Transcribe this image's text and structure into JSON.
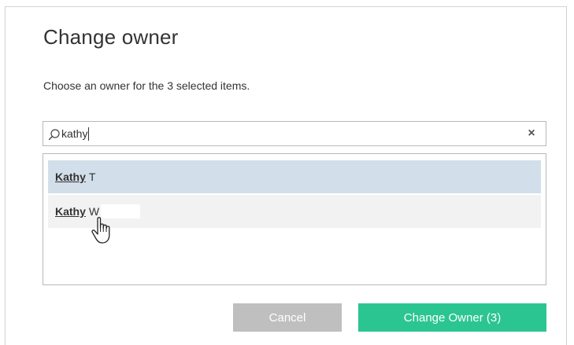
{
  "dialog": {
    "title": "Change owner",
    "subtitle": "Choose an owner for the 3 selected items."
  },
  "search": {
    "value": "kathy",
    "icon": "search-icon",
    "clear_icon": "close-icon",
    "clear_glyph": "×"
  },
  "results": [
    {
      "match": "Kathy",
      "rest": "T",
      "state": "selected"
    },
    {
      "match": "Kathy",
      "rest": "W",
      "state": "hover"
    }
  ],
  "buttons": {
    "cancel_label": "Cancel",
    "change_owner_label": "Change Owner (3)"
  },
  "colors": {
    "selected_row": "#d2dee9",
    "hover_row": "#f2f2f2",
    "cancel_button": "#bfbfbf",
    "primary_button": "#2bc592"
  }
}
